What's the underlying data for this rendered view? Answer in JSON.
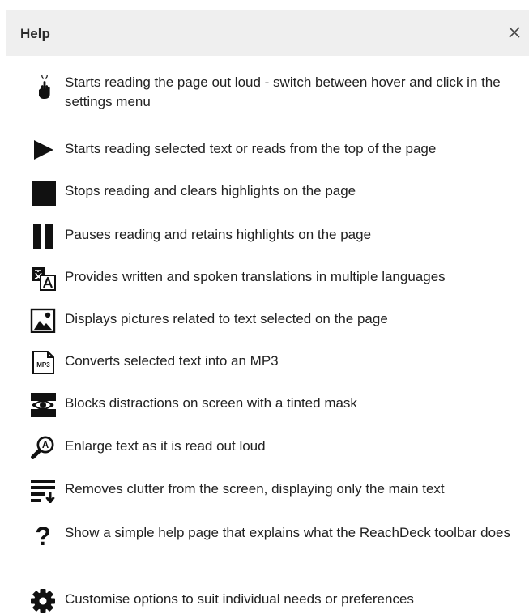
{
  "header": {
    "title": "Help",
    "close_label": "×"
  },
  "items": [
    {
      "icon": "hover-hand-icon",
      "text": "Starts reading the page out loud - switch between hover and click in the settings menu"
    },
    {
      "icon": "play-icon",
      "text": "Starts reading selected text or reads from the top of the page"
    },
    {
      "icon": "stop-icon",
      "text": "Stops reading and clears highlights on the page"
    },
    {
      "icon": "pause-icon",
      "text": "Pauses reading and retains highlights on the page"
    },
    {
      "icon": "translate-icon",
      "text": "Provides written and spoken translations in multiple languages"
    },
    {
      "icon": "picture-dictionary-icon",
      "text": "Displays pictures related to text selected on the page"
    },
    {
      "icon": "mp3-icon",
      "icon_text": "MP3",
      "text": "Converts selected text into an MP3"
    },
    {
      "icon": "screen-mask-icon",
      "text": "Blocks distractions on screen with a tinted mask"
    },
    {
      "icon": "magnifier-icon",
      "icon_text": "A",
      "text": "Enlarge text as it is read out loud"
    },
    {
      "icon": "simplify-icon",
      "text": "Removes clutter from the screen, displaying only the main text"
    },
    {
      "icon": "help-icon",
      "icon_text": "?",
      "text": "Show a simple help page that explains what the ReachDeck toolbar does"
    },
    {
      "icon": "settings-gear-icon",
      "text": "Customise options to suit individual needs or preferences"
    }
  ]
}
